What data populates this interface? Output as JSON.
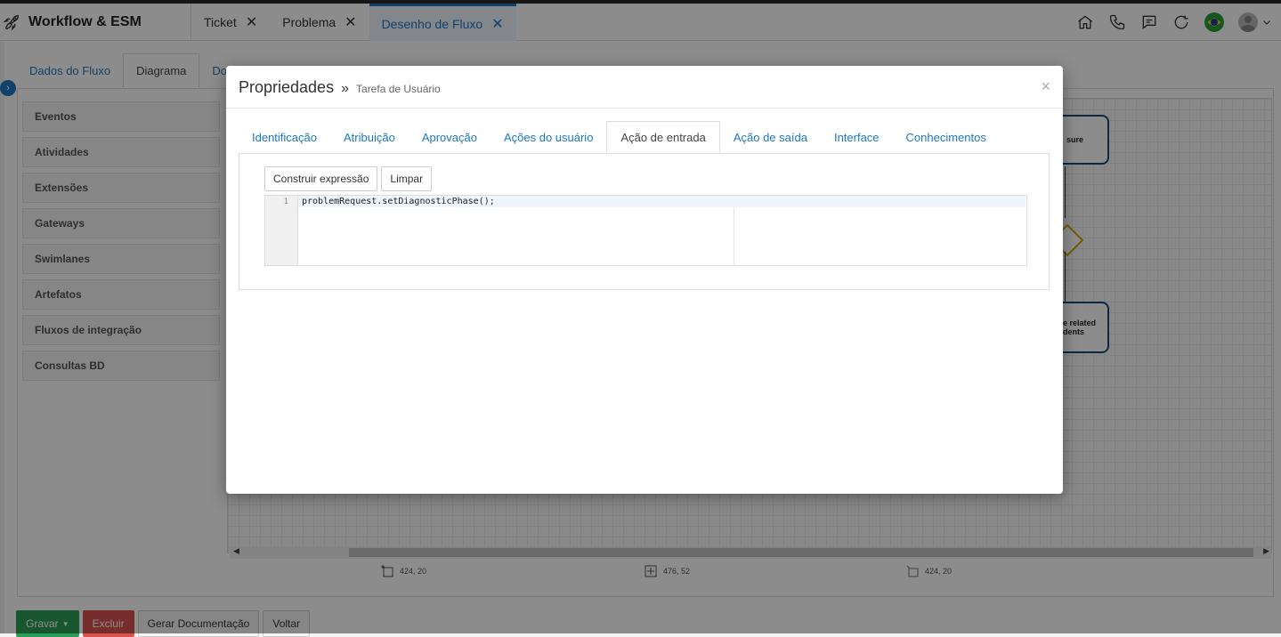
{
  "app": {
    "title": "Workflow & ESM"
  },
  "top_tabs": [
    {
      "label": "Ticket",
      "active": false
    },
    {
      "label": "Problema",
      "active": false
    },
    {
      "label": "Desenho de Fluxo",
      "active": true
    }
  ],
  "top_icons": [
    "home-icon",
    "phone-icon",
    "chat-icon",
    "refresh-icon",
    "brazil-flag-icon",
    "user-avatar",
    "chevron-down-icon"
  ],
  "inner_tabs": [
    {
      "label": "Dados do Fluxo",
      "active": false
    },
    {
      "label": "Diagrama",
      "active": true
    },
    {
      "label": "Do",
      "active": false
    }
  ],
  "palette": [
    "Eventos",
    "Atividades",
    "Extensões",
    "Gateways",
    "Swimlanes",
    "Artefatos",
    "Fluxos de integração",
    "Consultas BD"
  ],
  "diagram": {
    "box1_text": "sure",
    "box2_text_line1": "e related",
    "box2_text_line2": "dents"
  },
  "coords": [
    "424, 20",
    "476, 52",
    "424, 20"
  ],
  "bottom_buttons": {
    "save": "Gravar",
    "delete": "Excluir",
    "generate": "Gerar Documentação",
    "back": "Voltar"
  },
  "modal": {
    "title": "Propriedades",
    "separator": "»",
    "subtitle": "Tarefa de Usuário",
    "close": "×",
    "tabs": [
      {
        "label": "Identificação",
        "active": false
      },
      {
        "label": "Atribuição",
        "active": false
      },
      {
        "label": "Aprovação",
        "active": false
      },
      {
        "label": "Ações do usuário",
        "active": false
      },
      {
        "label": "Ação de entrada",
        "active": true
      },
      {
        "label": "Ação de saída",
        "active": false
      },
      {
        "label": "Interface",
        "active": false
      },
      {
        "label": "Conhecimentos",
        "active": false
      }
    ],
    "build_button": "Construir expressão",
    "clear_button": "Limpar",
    "editor": {
      "line_number": "1",
      "code": "problemRequest.setDiagnosticPhase();"
    }
  },
  "colors": {
    "accent": "#1f78c1",
    "save": "#2a9d57",
    "delete": "#d9534f"
  }
}
